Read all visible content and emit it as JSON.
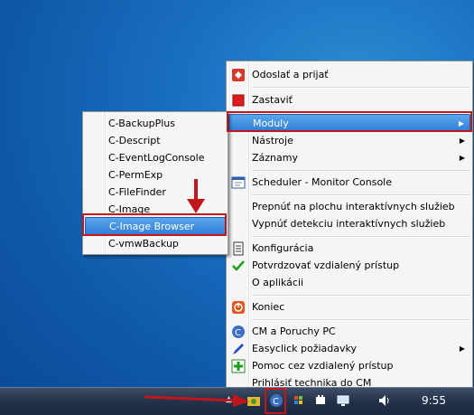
{
  "main_menu": {
    "items": [
      {
        "label": "Odoslať a prijať",
        "icon": "send-receive-icon"
      },
      {
        "label": "Zastaviť",
        "icon": "stop-icon"
      },
      {
        "label": "Moduly",
        "icon": "",
        "submenu": true
      },
      {
        "label": "Nástroje",
        "icon": "",
        "submenu": true
      },
      {
        "label": "Záznamy",
        "icon": "",
        "submenu": true
      },
      {
        "label": "Scheduler - Monitor Console",
        "icon": "scheduler-icon"
      },
      {
        "label": "Prepnúť na plochu interaktívnych služieb",
        "icon": ""
      },
      {
        "label": "Vypnúť detekciu interaktívnych služieb",
        "icon": ""
      },
      {
        "label": "Konfigurácia",
        "icon": "configuration-icon"
      },
      {
        "label": "Potvrdzovať vzdialený prístup",
        "icon": "checkmark-icon"
      },
      {
        "label": "O aplikácii",
        "icon": ""
      },
      {
        "label": "Koniec",
        "icon": "exit-icon"
      },
      {
        "label": "CM a Poruchy PC",
        "icon": "cm-icon"
      },
      {
        "label": "Easyclick požiadavky",
        "icon": "pen-icon",
        "submenu": true
      },
      {
        "label": "Pomoc cez vzdialený prístup",
        "icon": "remote-help-icon"
      },
      {
        "label": "Prihlásiť technika do CM",
        "icon": ""
      }
    ]
  },
  "sub_menu": {
    "items": [
      {
        "label": "C-BackupPlus"
      },
      {
        "label": "C-Descript"
      },
      {
        "label": "C-EventLogConsole"
      },
      {
        "label": "C-PermExp"
      },
      {
        "label": "C-FileFinder"
      },
      {
        "label": "C-Image"
      },
      {
        "label": "C-Image Browser"
      },
      {
        "label": "C-vmwBackup"
      }
    ]
  },
  "taskbar": {
    "clock": "9:55"
  },
  "colors": {
    "highlight": "#3a8be0",
    "annotation_red": "#c0161c"
  }
}
